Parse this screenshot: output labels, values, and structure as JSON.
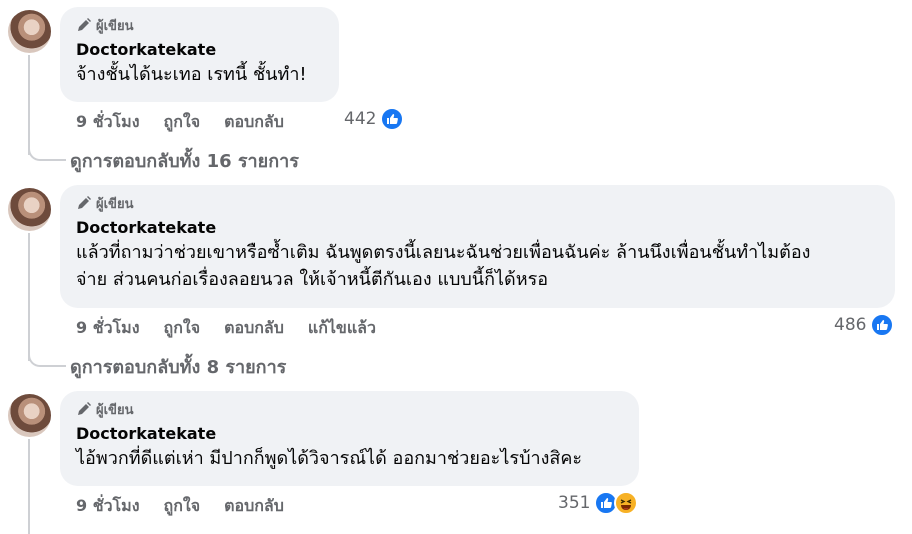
{
  "comments": [
    {
      "badge": "ผู้เขียน",
      "author": "Doctorkatekate",
      "text_lines": [
        "จ้างชั้นได้นะเทอ เรทนี้ ชั้นทำ!"
      ],
      "time": "9 ชั่วโมง",
      "like": "ถูกใจ",
      "reply": "ตอบกลับ",
      "edited": "",
      "reaction_count": "442",
      "reactions": [
        "like-icon"
      ],
      "view_replies": "ดูการตอบกลับทั้ง 16 รายการ"
    },
    {
      "badge": "ผู้เขียน",
      "author": "Doctorkatekate",
      "text_lines": [
        "แล้วที่ถามว่าช่วยเขาหรือซ้ำเติม ฉันพูดตรงนี้เลยนะฉันช่วยเพื่อนฉันค่ะ ล้านนึงเพื่อนชั้นทำไมต้อง",
        "จ่าย ส่วนคนก่อเรื่องลอยนวล ให้เจ้าหนี้ตีกันเอง แบบนี้ก็ได้หรอ"
      ],
      "time": "9 ชั่วโมง",
      "like": "ถูกใจ",
      "reply": "ตอบกลับ",
      "edited": "แก้ไขแล้ว",
      "reaction_count": "486",
      "reactions": [
        "like-icon"
      ],
      "view_replies": "ดูการตอบกลับทั้ง 8 รายการ"
    },
    {
      "badge": "ผู้เขียน",
      "author": "Doctorkatekate",
      "text_lines": [
        "ไอ้พวกที่ดีแต่เห่า มีปากก็พูดได้วิจารณ์ได้ ออกมาช่วยอะไรบ้างสิคะ"
      ],
      "time": "9 ชั่วโมง",
      "like": "ถูกใจ",
      "reply": "ตอบกลับ",
      "edited": "",
      "reaction_count": "351",
      "reactions": [
        "like-icon",
        "haha-icon"
      ],
      "view_replies": ""
    }
  ],
  "colors": {
    "accent": "#1877f2",
    "bubble": "#f0f2f5",
    "secondary_text": "#65676b"
  }
}
